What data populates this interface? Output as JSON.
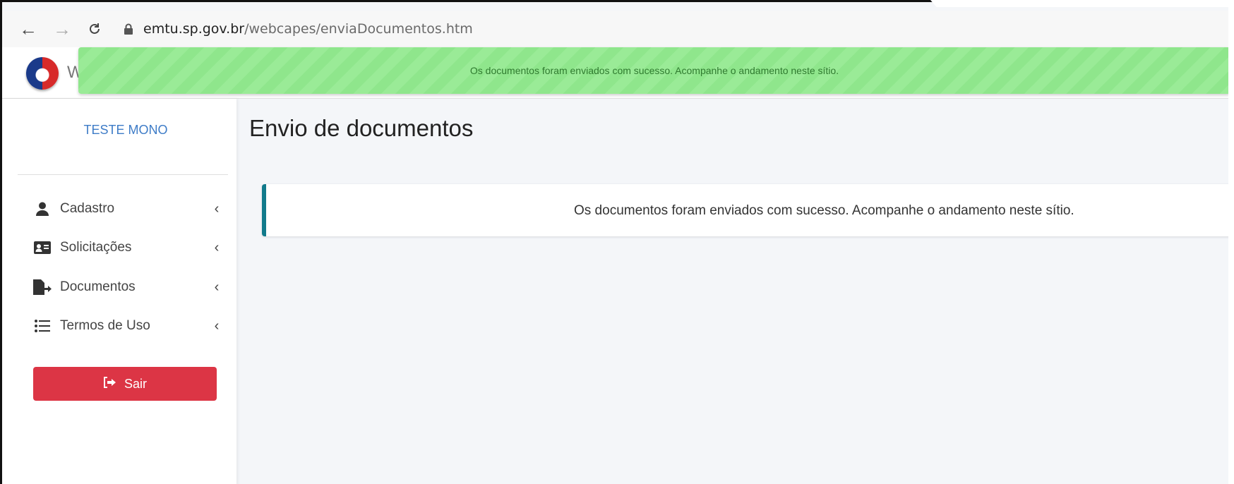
{
  "browser": {
    "url_domain": "emtu.sp.gov.br",
    "url_path": "/webcapes/enviaDocumentos.htm"
  },
  "header": {
    "brand_initial": "W",
    "toast_message": "Os documentos foram enviados com sucesso. Acompanhe o andamento neste sítio."
  },
  "sidebar": {
    "username": "TESTE MONO",
    "items": [
      {
        "label": "Cadastro",
        "icon": "user-icon"
      },
      {
        "label": "Solicitações",
        "icon": "id-card-icon"
      },
      {
        "label": "Documentos",
        "icon": "file-export-icon"
      },
      {
        "label": "Termos de Uso",
        "icon": "list-icon"
      }
    ],
    "logout_label": "Sair"
  },
  "main": {
    "title": "Envio de documentos",
    "message": "Os documentos foram enviados com sucesso. Acompanhe o andamento neste sítio."
  },
  "colors": {
    "toast_bg": "#90e78d",
    "callout_border": "#117a8b",
    "logout_button": "#dc3545",
    "username": "#3e7cc7"
  }
}
